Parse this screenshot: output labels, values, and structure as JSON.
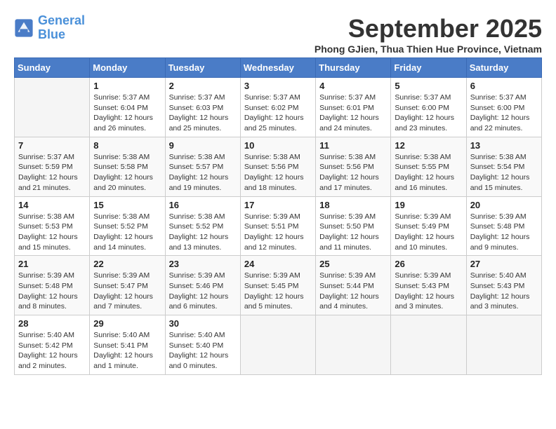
{
  "header": {
    "logo_line1": "General",
    "logo_line2": "Blue",
    "month": "September 2025",
    "location": "Phong GJien, Thua Thien Hue Province, Vietnam"
  },
  "weekdays": [
    "Sunday",
    "Monday",
    "Tuesday",
    "Wednesday",
    "Thursday",
    "Friday",
    "Saturday"
  ],
  "weeks": [
    [
      {
        "day": "",
        "info": ""
      },
      {
        "day": "1",
        "info": "Sunrise: 5:37 AM\nSunset: 6:04 PM\nDaylight: 12 hours\nand 26 minutes."
      },
      {
        "day": "2",
        "info": "Sunrise: 5:37 AM\nSunset: 6:03 PM\nDaylight: 12 hours\nand 25 minutes."
      },
      {
        "day": "3",
        "info": "Sunrise: 5:37 AM\nSunset: 6:02 PM\nDaylight: 12 hours\nand 25 minutes."
      },
      {
        "day": "4",
        "info": "Sunrise: 5:37 AM\nSunset: 6:01 PM\nDaylight: 12 hours\nand 24 minutes."
      },
      {
        "day": "5",
        "info": "Sunrise: 5:37 AM\nSunset: 6:00 PM\nDaylight: 12 hours\nand 23 minutes."
      },
      {
        "day": "6",
        "info": "Sunrise: 5:37 AM\nSunset: 6:00 PM\nDaylight: 12 hours\nand 22 minutes."
      }
    ],
    [
      {
        "day": "7",
        "info": "Sunrise: 5:37 AM\nSunset: 5:59 PM\nDaylight: 12 hours\nand 21 minutes."
      },
      {
        "day": "8",
        "info": "Sunrise: 5:38 AM\nSunset: 5:58 PM\nDaylight: 12 hours\nand 20 minutes."
      },
      {
        "day": "9",
        "info": "Sunrise: 5:38 AM\nSunset: 5:57 PM\nDaylight: 12 hours\nand 19 minutes."
      },
      {
        "day": "10",
        "info": "Sunrise: 5:38 AM\nSunset: 5:56 PM\nDaylight: 12 hours\nand 18 minutes."
      },
      {
        "day": "11",
        "info": "Sunrise: 5:38 AM\nSunset: 5:56 PM\nDaylight: 12 hours\nand 17 minutes."
      },
      {
        "day": "12",
        "info": "Sunrise: 5:38 AM\nSunset: 5:55 PM\nDaylight: 12 hours\nand 16 minutes."
      },
      {
        "day": "13",
        "info": "Sunrise: 5:38 AM\nSunset: 5:54 PM\nDaylight: 12 hours\nand 15 minutes."
      }
    ],
    [
      {
        "day": "14",
        "info": "Sunrise: 5:38 AM\nSunset: 5:53 PM\nDaylight: 12 hours\nand 15 minutes."
      },
      {
        "day": "15",
        "info": "Sunrise: 5:38 AM\nSunset: 5:52 PM\nDaylight: 12 hours\nand 14 minutes."
      },
      {
        "day": "16",
        "info": "Sunrise: 5:38 AM\nSunset: 5:52 PM\nDaylight: 12 hours\nand 13 minutes."
      },
      {
        "day": "17",
        "info": "Sunrise: 5:39 AM\nSunset: 5:51 PM\nDaylight: 12 hours\nand 12 minutes."
      },
      {
        "day": "18",
        "info": "Sunrise: 5:39 AM\nSunset: 5:50 PM\nDaylight: 12 hours\nand 11 minutes."
      },
      {
        "day": "19",
        "info": "Sunrise: 5:39 AM\nSunset: 5:49 PM\nDaylight: 12 hours\nand 10 minutes."
      },
      {
        "day": "20",
        "info": "Sunrise: 5:39 AM\nSunset: 5:48 PM\nDaylight: 12 hours\nand 9 minutes."
      }
    ],
    [
      {
        "day": "21",
        "info": "Sunrise: 5:39 AM\nSunset: 5:48 PM\nDaylight: 12 hours\nand 8 minutes."
      },
      {
        "day": "22",
        "info": "Sunrise: 5:39 AM\nSunset: 5:47 PM\nDaylight: 12 hours\nand 7 minutes."
      },
      {
        "day": "23",
        "info": "Sunrise: 5:39 AM\nSunset: 5:46 PM\nDaylight: 12 hours\nand 6 minutes."
      },
      {
        "day": "24",
        "info": "Sunrise: 5:39 AM\nSunset: 5:45 PM\nDaylight: 12 hours\nand 5 minutes."
      },
      {
        "day": "25",
        "info": "Sunrise: 5:39 AM\nSunset: 5:44 PM\nDaylight: 12 hours\nand 4 minutes."
      },
      {
        "day": "26",
        "info": "Sunrise: 5:39 AM\nSunset: 5:43 PM\nDaylight: 12 hours\nand 3 minutes."
      },
      {
        "day": "27",
        "info": "Sunrise: 5:40 AM\nSunset: 5:43 PM\nDaylight: 12 hours\nand 3 minutes."
      }
    ],
    [
      {
        "day": "28",
        "info": "Sunrise: 5:40 AM\nSunset: 5:42 PM\nDaylight: 12 hours\nand 2 minutes."
      },
      {
        "day": "29",
        "info": "Sunrise: 5:40 AM\nSunset: 5:41 PM\nDaylight: 12 hours\nand 1 minute."
      },
      {
        "day": "30",
        "info": "Sunrise: 5:40 AM\nSunset: 5:40 PM\nDaylight: 12 hours\nand 0 minutes."
      },
      {
        "day": "",
        "info": ""
      },
      {
        "day": "",
        "info": ""
      },
      {
        "day": "",
        "info": ""
      },
      {
        "day": "",
        "info": ""
      }
    ]
  ]
}
